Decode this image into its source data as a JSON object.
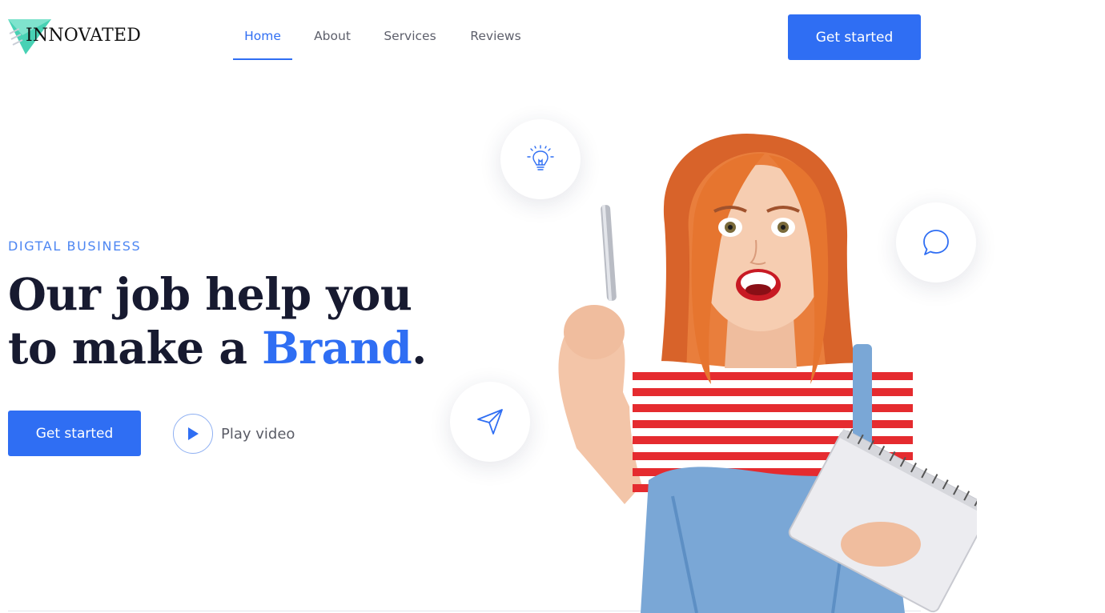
{
  "brand": {
    "name": "INNOVATED"
  },
  "nav": {
    "items": [
      {
        "label": "Home",
        "active": true
      },
      {
        "label": "About",
        "active": false
      },
      {
        "label": "Services",
        "active": false
      },
      {
        "label": "Reviews",
        "active": false
      }
    ]
  },
  "header": {
    "cta_label": "Get started"
  },
  "hero": {
    "eyebrow": "DIGTAL BUSINESS",
    "headline_line1": "Our job help you",
    "headline_line2_prefix": "to make a ",
    "headline_accent": "Brand",
    "headline_suffix": ".",
    "cta_label": "Get started",
    "play_label": "Play video"
  },
  "floating_icons": [
    "lightbulb-icon",
    "chat-bubble-icon",
    "paper-plane-icon"
  ],
  "colors": {
    "accent": "#2f6ef3",
    "eyebrow": "#4d86f2",
    "heading": "#171a30",
    "logo_mark": "#48d1b4"
  }
}
